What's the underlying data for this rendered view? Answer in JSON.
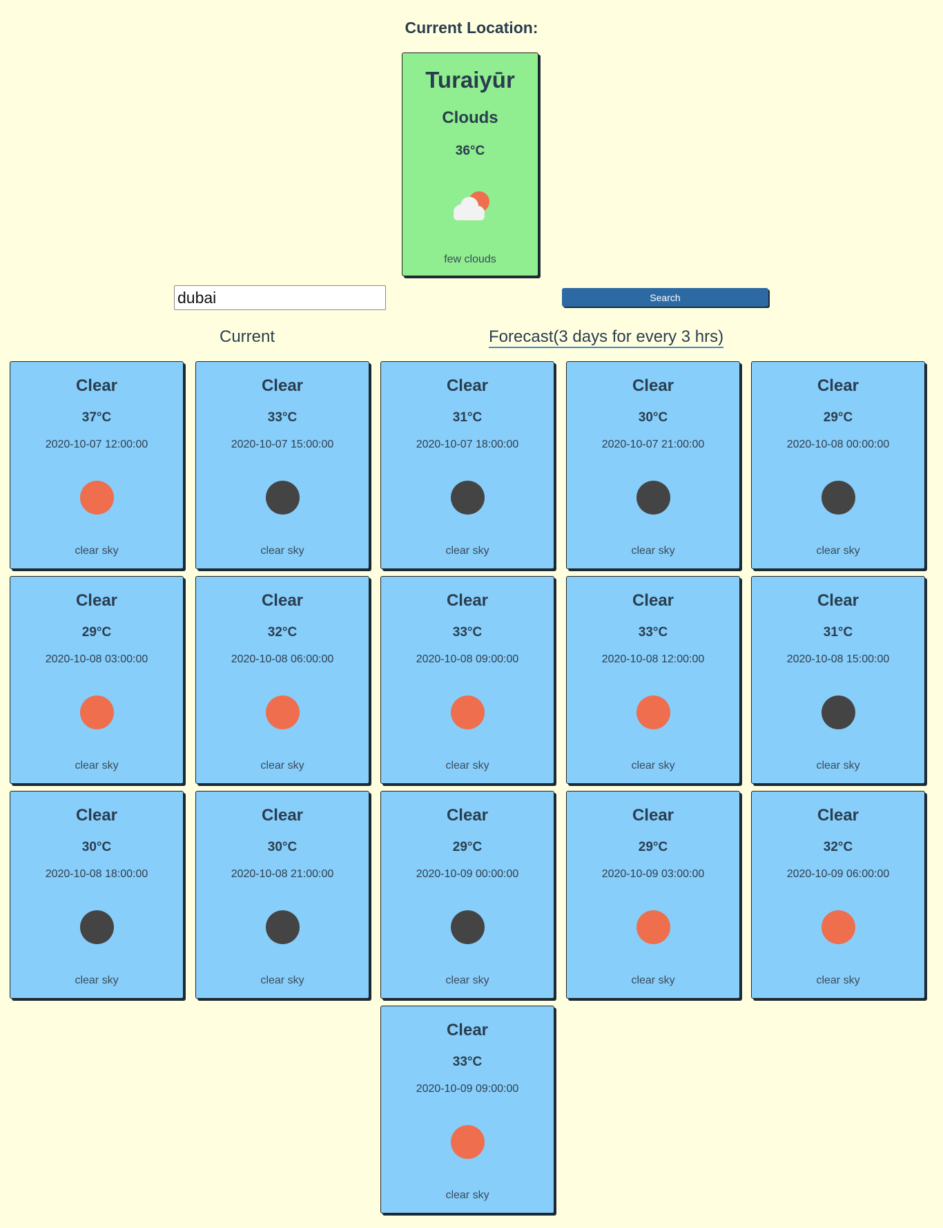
{
  "header": {
    "title": "Current Location:"
  },
  "current_location": {
    "city": "Turaiyūr",
    "main": "Clouds",
    "temp": "36°C",
    "icon": "few-clouds-icon",
    "description": "few clouds"
  },
  "search": {
    "value": "dubai",
    "button_label": "Search"
  },
  "tabs": [
    {
      "label": "Current"
    },
    {
      "label": "Forecast(3 days for every 3 hrs)"
    }
  ],
  "colors": {
    "sun": "#ee6e4d",
    "moon": "#444444",
    "card_bg": "#87cefa",
    "current_card_bg": "#90ee90",
    "page_bg": "#ffffe0",
    "button_bg": "#2d6aa3"
  },
  "forecast": [
    {
      "main": "Clear",
      "temp": "37°C",
      "datetime": "2020-10-07 12:00:00",
      "icon": "sun-icon",
      "description": "clear sky"
    },
    {
      "main": "Clear",
      "temp": "33°C",
      "datetime": "2020-10-07 15:00:00",
      "icon": "moon-icon",
      "description": "clear sky"
    },
    {
      "main": "Clear",
      "temp": "31°C",
      "datetime": "2020-10-07 18:00:00",
      "icon": "moon-icon",
      "description": "clear sky"
    },
    {
      "main": "Clear",
      "temp": "30°C",
      "datetime": "2020-10-07 21:00:00",
      "icon": "moon-icon",
      "description": "clear sky"
    },
    {
      "main": "Clear",
      "temp": "29°C",
      "datetime": "2020-10-08 00:00:00",
      "icon": "moon-icon",
      "description": "clear sky"
    },
    {
      "main": "Clear",
      "temp": "29°C",
      "datetime": "2020-10-08 03:00:00",
      "icon": "sun-icon",
      "description": "clear sky"
    },
    {
      "main": "Clear",
      "temp": "32°C",
      "datetime": "2020-10-08 06:00:00",
      "icon": "sun-icon",
      "description": "clear sky"
    },
    {
      "main": "Clear",
      "temp": "33°C",
      "datetime": "2020-10-08 09:00:00",
      "icon": "sun-icon",
      "description": "clear sky"
    },
    {
      "main": "Clear",
      "temp": "33°C",
      "datetime": "2020-10-08 12:00:00",
      "icon": "sun-icon",
      "description": "clear sky"
    },
    {
      "main": "Clear",
      "temp": "31°C",
      "datetime": "2020-10-08 15:00:00",
      "icon": "moon-icon",
      "description": "clear sky"
    },
    {
      "main": "Clear",
      "temp": "30°C",
      "datetime": "2020-10-08 18:00:00",
      "icon": "moon-icon",
      "description": "clear sky"
    },
    {
      "main": "Clear",
      "temp": "30°C",
      "datetime": "2020-10-08 21:00:00",
      "icon": "moon-icon",
      "description": "clear sky"
    },
    {
      "main": "Clear",
      "temp": "29°C",
      "datetime": "2020-10-09 00:00:00",
      "icon": "moon-icon",
      "description": "clear sky"
    },
    {
      "main": "Clear",
      "temp": "29°C",
      "datetime": "2020-10-09 03:00:00",
      "icon": "sun-icon",
      "description": "clear sky"
    },
    {
      "main": "Clear",
      "temp": "32°C",
      "datetime": "2020-10-09 06:00:00",
      "icon": "sun-icon",
      "description": "clear sky"
    },
    {
      "main": "Clear",
      "temp": "33°C",
      "datetime": "2020-10-09 09:00:00",
      "icon": "sun-icon",
      "description": "clear sky"
    }
  ]
}
